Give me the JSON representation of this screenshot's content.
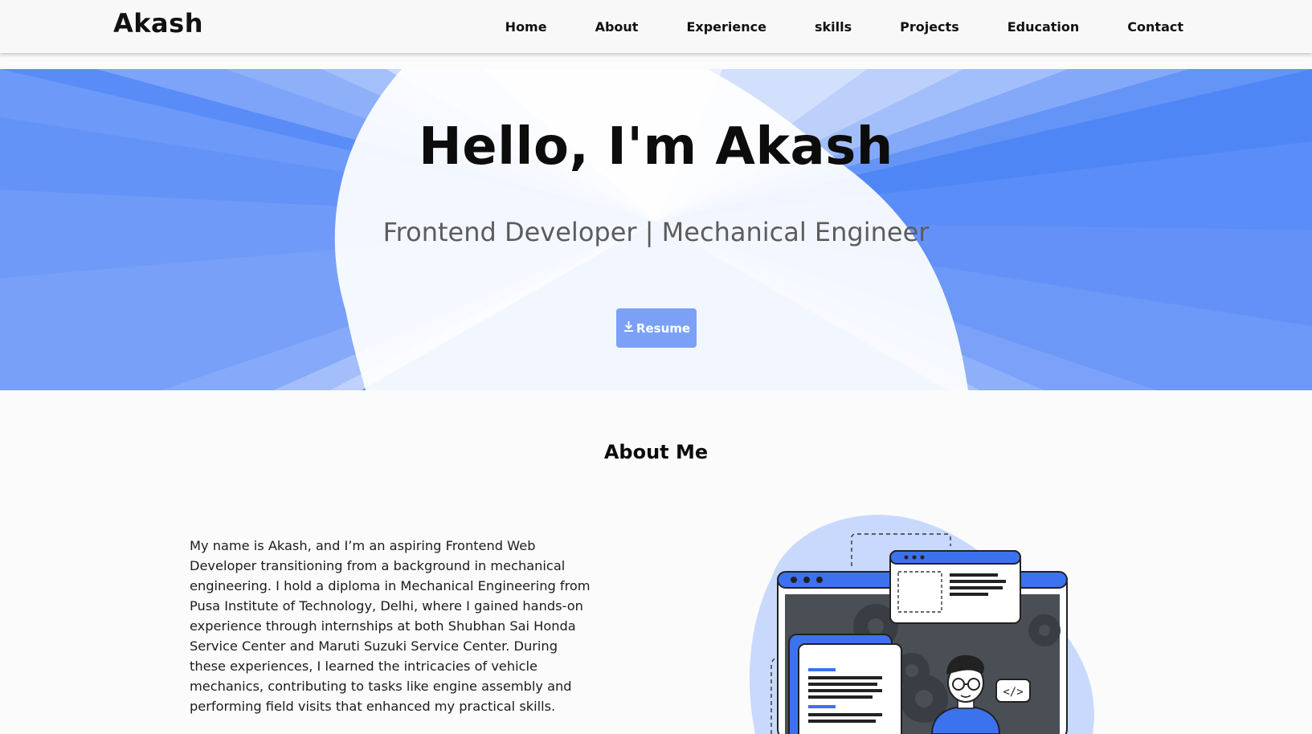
{
  "brand": "Akash",
  "nav": {
    "items": [
      {
        "label": "Home",
        "name": "nav-home"
      },
      {
        "label": "About",
        "name": "nav-about"
      },
      {
        "label": "Experience",
        "name": "nav-experience"
      },
      {
        "label": "skills",
        "name": "nav-skills"
      },
      {
        "label": "Projects",
        "name": "nav-projects"
      },
      {
        "label": "Education",
        "name": "nav-education"
      },
      {
        "label": "Contact",
        "name": "nav-contact"
      }
    ]
  },
  "hero": {
    "title": "Hello, I'm Akash",
    "subtitle": "Frontend Developer | Mechanical Engineer",
    "resume_label": "Resume",
    "resume_icon": "download-icon"
  },
  "about": {
    "heading": "About Me",
    "text": "My name is Akash, and I’m an aspiring Frontend Web Developer transitioning from a background in mechanical engineering. I hold a diploma in Mechanical Engineering from Pusa Institute of Technology, Delhi, where I gained hands-on experience through internships at both Shubhan Sai Honda Service Center and Maruti Suzuki Service Center. During these experiences, I learned the intricacies of vehicle mechanics, contributing to tasks like engine assembly and performing field visits that enhanced my practical skills.",
    "illustration": "developer-illustration"
  },
  "colors": {
    "accent": "#4c84f6",
    "accent_light": "#7aa1f6",
    "hero_pale": "#dbe6fd",
    "text_dark": "#0c0c0c",
    "subtitle": "#5c5c5c"
  }
}
